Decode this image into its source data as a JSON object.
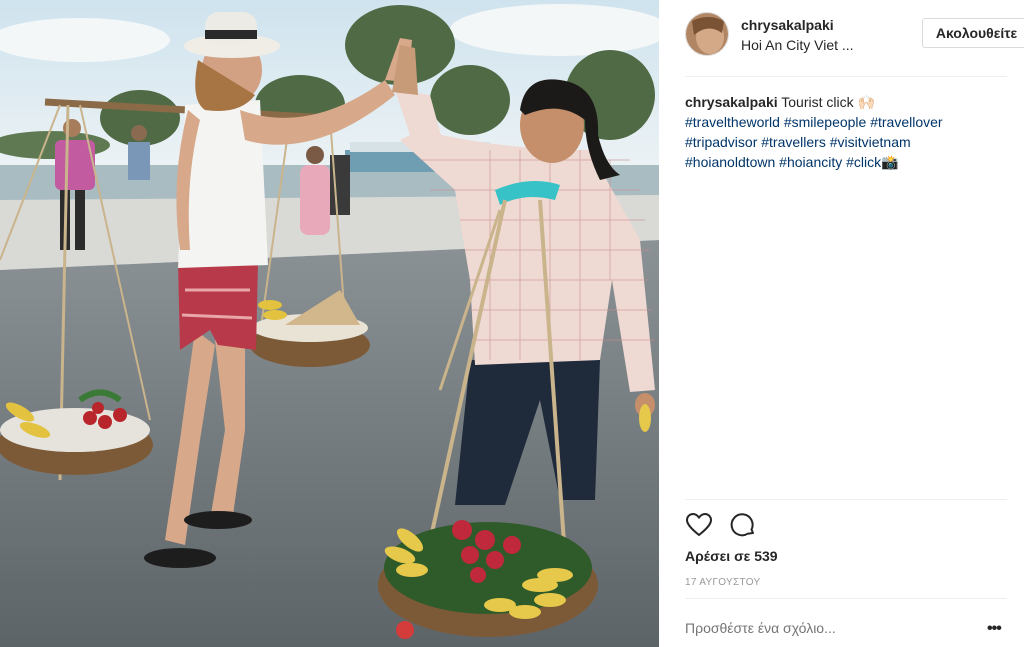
{
  "post": {
    "username": "chrysakalpaki",
    "location": "Hoi An City Viet ...",
    "follow_label": "Ακολουθείτε",
    "caption": {
      "username": "chrysakalpaki",
      "text": "Tourist click 🙌🏻",
      "hashtag_lines": [
        "#traveltheworld #smilepeople #travellover",
        "#tripadvisor #travellers #visitvietnam",
        "#hoianoldtown #hoiancity #click📸"
      ]
    },
    "likes": "Αρέσει σε 539",
    "date": "17 ΑΥΓΟΥΣΤΟΥ",
    "comment_placeholder": "Προσθέστε ένα σχόλιο...",
    "more_label": "•••"
  },
  "icons": {
    "like": "heart-icon",
    "comment": "comment-icon",
    "more": "more-options-icon"
  },
  "colors": {
    "hashtag": "#003569",
    "text": "#262626",
    "muted": "#999999",
    "divider": "#efefef"
  }
}
